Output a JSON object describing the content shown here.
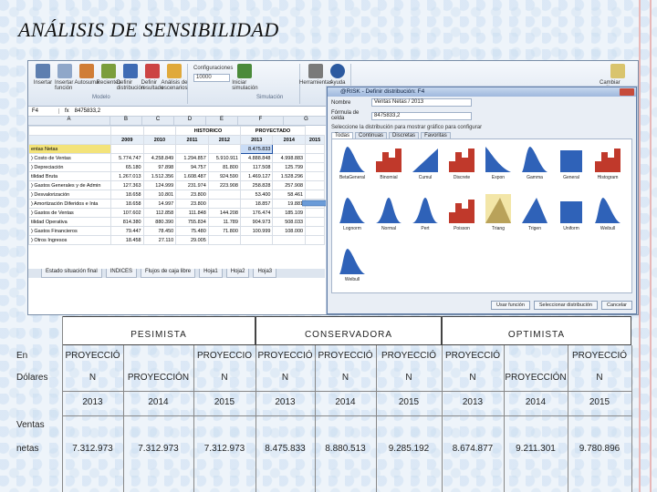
{
  "slide": {
    "title": "ANÁLISIS DE SENSIBILIDAD"
  },
  "excel": {
    "ribbon": {
      "buttons": [
        "Insertar",
        "Insertar función",
        "Autosuma",
        "Recientes",
        "Definir distribución",
        "Definir resultado",
        "Análisis de escenarios",
        "Configuraciones",
        "Iniciar simulación",
        "Herramientas",
        "Ayuda",
        "Cambiar estilos"
      ],
      "group_model": "Modelo",
      "group_sim": "Simulación",
      "settings_value": "Configuraciones",
      "iterations": "10000"
    },
    "name_box": "F4",
    "formula": "8475833,2",
    "columns": [
      "A",
      "B",
      "C",
      "D",
      "E",
      "F",
      "G"
    ],
    "headers": {
      "historico": "HISTORICO",
      "proyectado": "PROYECTADO"
    },
    "years": [
      "",
      "2009",
      "2010",
      "2011",
      "2012",
      "2013",
      "2014",
      "2015"
    ],
    "rows": [
      {
        "label": "entas Netas",
        "values": [
          "",
          "",
          "",
          "",
          "8.475.833",
          "",
          ""
        ]
      },
      {
        "label": ") Costo de Ventas",
        "values": [
          "5.774.747",
          "4.258.849",
          "1.294.857",
          "5.910.911",
          "4.888.848",
          "4.998.883",
          ""
        ]
      },
      {
        "label": ") Depreciación",
        "values": [
          "65.180",
          "97.898",
          "94.757",
          "81.800",
          "117.508",
          "125.799",
          ""
        ]
      },
      {
        "label": "tilidad Bruta",
        "values": [
          "1.267.013",
          "1.512.356",
          "1.608.487",
          "924.590",
          "1.469.127",
          "1.528.296",
          ""
        ]
      },
      {
        "label": ") Gastos Generales y de Admin",
        "values": [
          "127.363",
          "124.999",
          "231.974",
          "223.908",
          "258.828",
          "257.908",
          ""
        ]
      },
      {
        "label": ") Desvalorización",
        "values": [
          "18.658",
          "10.801",
          "23.800",
          "",
          "53.400",
          "58.461",
          ""
        ]
      },
      {
        "label": ") Amortización Diferidos e Inta",
        "values": [
          "18.658",
          "14.997",
          "23.800",
          "",
          "18.857",
          "19.881",
          ""
        ]
      },
      {
        "label": ") Gastos de Ventas",
        "values": [
          "107.602",
          "112.858",
          "111.848",
          "144.208",
          "176.474",
          "185.109",
          ""
        ]
      },
      {
        "label": "tilidad Operativa",
        "values": [
          "814.380",
          "880.390",
          "755.834",
          "11.789",
          "904.973",
          "508.033",
          ""
        ]
      },
      {
        "label": ") Gastos Financieros",
        "values": [
          "79.447",
          "78.450",
          "75.480",
          "71.800",
          "100.999",
          "108.000",
          ""
        ]
      },
      {
        "label": ") Otros Ingresos",
        "values": [
          "18.458",
          "27.110",
          "29.005",
          "",
          "",
          "",
          ""
        ]
      }
    ],
    "sheet_tabs": [
      "Estado situación final",
      "INDICES",
      "Flujos de caja libre",
      "Hoja1",
      "Hoja2",
      "Hoja3"
    ]
  },
  "dialog": {
    "title": "@RISK - Definir distribución: F4",
    "name_label": "Nombre",
    "name_value": "Ventas Netas / 2013",
    "formula_label": "Fórmula de celda",
    "formula_value": "8475833,2",
    "hint": "Seleccione la distribución para mostrar gráfico para configurar",
    "tabs": [
      "Todas",
      "Continuas",
      "Discretas",
      "Favoritas"
    ],
    "distributions": [
      "BetaGeneral",
      "Binomial",
      "Cumul",
      "Discrete",
      "Expon",
      "Gamma",
      "General",
      "Histogram",
      "Lognorm",
      "Normal",
      "Pert",
      "Poisson",
      "Triang",
      "Trigen",
      "Uniform",
      "Weibull",
      "Weibull"
    ],
    "buttons": [
      "Usar función",
      "Seleccionar distribución",
      "Cancelar"
    ]
  },
  "table": {
    "headers": [
      "PESIMISTA",
      "CONSERVADORA",
      "OPTIMISTA"
    ],
    "row_labels": [
      "En",
      "Dólares",
      "",
      "Ventas",
      "netas"
    ],
    "line1": [
      "PROYECCIÓ",
      "",
      "PROYECCIO",
      "PROYECCIÓ",
      "PROYECCIÓ",
      "PROYECCIÓ",
      "PROYECCIÓ",
      "",
      "PROYECCIÓ"
    ],
    "line2": [
      "N",
      "PROYECCIÓN",
      "N",
      "N",
      "N",
      "N",
      "N",
      "PROYECCIÓN",
      "N"
    ],
    "years": [
      "2013",
      "2014",
      "2015",
      "2013",
      "2014",
      "2015",
      "2013",
      "2014",
      "2015"
    ],
    "values": [
      "7.312.973",
      "7.312.973",
      "7.312.973",
      "8.475.833",
      "8.880.513",
      "9.285.192",
      "8.674.877",
      "9.211.301",
      "9.780.896"
    ]
  },
  "colors": {
    "accent": "#1c4fa3",
    "highlight": "#f3e37a",
    "dist_blue": "#2f62b8",
    "dist_red": "#c0392b",
    "triang": "#b9a25a"
  }
}
